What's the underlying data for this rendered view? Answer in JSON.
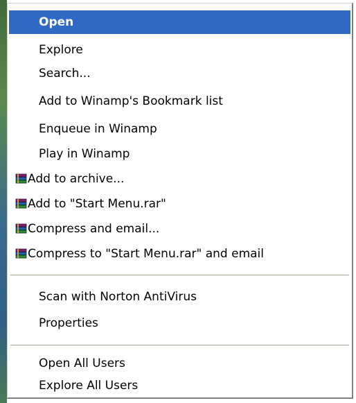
{
  "context_menu": {
    "items": [
      {
        "label": "Open",
        "highlighted": true,
        "icon": null
      },
      {
        "label": "Explore",
        "highlighted": false,
        "icon": null
      },
      {
        "label": "Search...",
        "highlighted": false,
        "icon": null
      },
      {
        "label": "Add to Winamp's Bookmark list",
        "highlighted": false,
        "icon": null
      },
      {
        "label": "Enqueue in Winamp",
        "highlighted": false,
        "icon": null
      },
      {
        "label": "Play in Winamp",
        "highlighted": false,
        "icon": null
      },
      {
        "label": "Add to archive...",
        "highlighted": false,
        "icon": "winrar-icon"
      },
      {
        "label": "Add to \"Start Menu.rar\"",
        "highlighted": false,
        "icon": "winrar-icon"
      },
      {
        "label": "Compress and email...",
        "highlighted": false,
        "icon": "winrar-icon"
      },
      {
        "label": "Compress to \"Start Menu.rar\" and email",
        "highlighted": false,
        "icon": "winrar-icon"
      },
      {
        "label": "Scan with Norton AntiVirus",
        "highlighted": false,
        "icon": null
      },
      {
        "label": "Properties",
        "highlighted": false,
        "icon": null
      },
      {
        "label": "Open All Users",
        "highlighted": false,
        "icon": null
      },
      {
        "label": "Explore All Users",
        "highlighted": false,
        "icon": null
      }
    ],
    "highlight_color": "#316ac5"
  }
}
